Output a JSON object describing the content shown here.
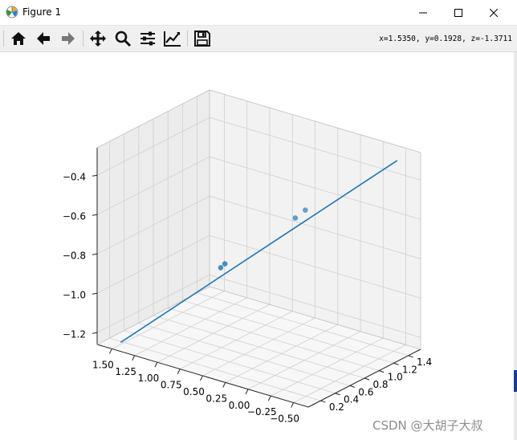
{
  "window": {
    "title": "Figure 1",
    "controls": {
      "minimize": "minimize",
      "maximize": "maximize",
      "close": "close"
    }
  },
  "toolbar": {
    "tools": [
      "home-icon",
      "back-icon",
      "forward-icon",
      "pan-icon",
      "zoom-icon",
      "configure-subplots-icon",
      "edit-axis-icon",
      "save-icon"
    ],
    "coords_text": "x=1.5350, y=0.1928, z=-1.3711"
  },
  "chart_data": {
    "type": "line",
    "projection": "3d",
    "title": "",
    "xlabel": "",
    "ylabel": "",
    "zlabel": "",
    "x_ticks": [
      "1.50",
      "1.25",
      "1.00",
      "0.75",
      "0.50",
      "0.25",
      "0.00",
      "−0.25",
      "−0.50"
    ],
    "y_ticks": [
      "0.2",
      "0.4",
      "0.6",
      "0.8",
      "1.0",
      "1.2",
      "1.4"
    ],
    "z_ticks": [
      "−1.2",
      "−1.0",
      "−0.8",
      "−0.6",
      "−0.4"
    ],
    "xlim": [
      -0.5,
      1.5
    ],
    "ylim": [
      0.2,
      1.4
    ],
    "zlim": [
      -1.2,
      -0.4
    ],
    "grid": true,
    "series": [
      {
        "kind": "line",
        "color": "#1f77b4",
        "x": [
          1.5,
          -0.5
        ],
        "y": [
          0.15,
          1.45
        ],
        "z": [
          -1.25,
          -0.3
        ]
      },
      {
        "kind": "scatter",
        "color": "#1f77b4",
        "x": [
          0.72,
          0.69,
          0.18,
          0.11
        ],
        "y": [
          0.55,
          0.57,
          0.9,
          0.95
        ],
        "z": [
          -0.84,
          -0.82,
          -0.58,
          -0.54
        ]
      }
    ]
  },
  "watermark": "CSDN @大胡子大叔"
}
